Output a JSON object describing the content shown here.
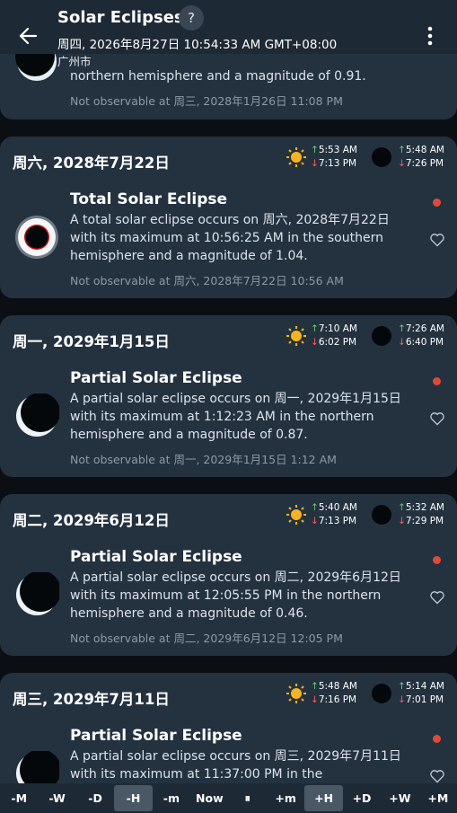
{
  "header": {
    "title": "Solar Eclipses",
    "datetime": "周四, 2026年8月27日 10:54:33 AM GMT+08:00",
    "city": "广州市"
  },
  "top_partial": {
    "desc_tail": "northern hemisphere and a magnitude of 0.91.",
    "note": "Not observable at 周三, 2028年1月26日 11:08 PM"
  },
  "cards": [
    {
      "date": "周六, 2028年7月22日",
      "sun_rise": "5:53 AM",
      "sun_set": "7:13 PM",
      "moon_rise": "5:48 AM",
      "moon_set": "7:26 PM",
      "title": "Total Solar Eclipse",
      "desc": "A total solar eclipse occurs on 周六, 2028年7月22日 with its maximum at 10:56:25 AM in the southern hemisphere and a magnitude of 1.04.",
      "note": "Not observable at 周六, 2028年7月22日 10:56 AM",
      "kind": "total"
    },
    {
      "date": "周一, 2029年1月15日",
      "sun_rise": "7:10 AM",
      "sun_set": "6:02 PM",
      "moon_rise": "7:26 AM",
      "moon_set": "6:40 PM",
      "title": "Partial Solar Eclipse",
      "desc": "A partial solar eclipse occurs on 周一, 2029年1月15日 with its maximum at 1:12:23 AM in the northern hemisphere and a magnitude of 0.87.",
      "note": "Not observable at 周一, 2029年1月15日 1:12 AM",
      "kind": "partial"
    },
    {
      "date": "周二, 2029年6月12日",
      "sun_rise": "5:40 AM",
      "sun_set": "7:13 PM",
      "moon_rise": "5:32 AM",
      "moon_set": "7:29 PM",
      "title": "Partial Solar Eclipse",
      "desc": "A partial solar eclipse occurs on 周二, 2029年6月12日 with its maximum at 12:05:55 PM in the northern hemisphere and a magnitude of 0.46.",
      "note": "Not observable at 周二, 2029年6月12日 12:05 PM",
      "kind": "partial"
    },
    {
      "date": "周三, 2029年7月11日",
      "sun_rise": "5:48 AM",
      "sun_set": "7:16 PM",
      "moon_rise": "5:14 AM",
      "moon_set": "7:01 PM",
      "title": "Partial Solar Eclipse",
      "desc": "A partial solar eclipse occurs on 周三, 2029年7月11日 with its maximum at 11:37:00 PM in the",
      "note": "",
      "kind": "partial"
    }
  ],
  "bottom_bar": [
    "-M",
    "-W",
    "-D",
    "-H",
    "-m",
    "Now",
    "⏸",
    "+m",
    "+H",
    "+D",
    "+W",
    "+M"
  ],
  "colors": {
    "header_bg": "#1e2936",
    "card_bg": "#243240",
    "rise": "#62d26f",
    "set": "#ff5c5c",
    "dot": "#e04a3a"
  },
  "icons": [
    "back-arrow-icon",
    "help-icon",
    "more-vert-icon",
    "sun-icon",
    "moon-icon",
    "heart-icon",
    "pause-icon"
  ]
}
